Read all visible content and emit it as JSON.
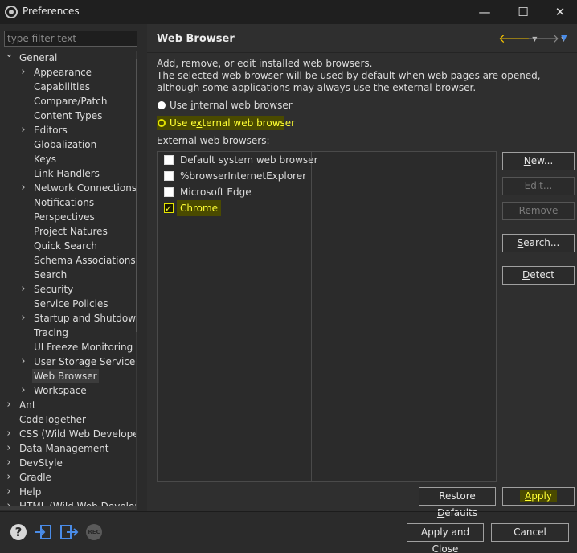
{
  "window": {
    "title": "Preferences",
    "minimize": "—",
    "maximize": "☐",
    "close": "✕"
  },
  "filter": {
    "placeholder": "type filter text",
    "value": ""
  },
  "tree": [
    {
      "label": "General",
      "arrow": "⌄",
      "level": 0
    },
    {
      "label": "Appearance",
      "arrow": "›",
      "level": 1
    },
    {
      "label": "Capabilities",
      "arrow": "",
      "level": 1
    },
    {
      "label": "Compare/Patch",
      "arrow": "",
      "level": 1
    },
    {
      "label": "Content Types",
      "arrow": "",
      "level": 1
    },
    {
      "label": "Editors",
      "arrow": "›",
      "level": 1
    },
    {
      "label": "Globalization",
      "arrow": "",
      "level": 1
    },
    {
      "label": "Keys",
      "arrow": "",
      "level": 1
    },
    {
      "label": "Link Handlers",
      "arrow": "",
      "level": 1
    },
    {
      "label": "Network Connections",
      "arrow": "›",
      "level": 1
    },
    {
      "label": "Notifications",
      "arrow": "",
      "level": 1
    },
    {
      "label": "Perspectives",
      "arrow": "",
      "level": 1
    },
    {
      "label": "Project Natures",
      "arrow": "",
      "level": 1
    },
    {
      "label": "Quick Search",
      "arrow": "",
      "level": 1
    },
    {
      "label": "Schema Associations",
      "arrow": "",
      "level": 1
    },
    {
      "label": "Search",
      "arrow": "",
      "level": 1
    },
    {
      "label": "Security",
      "arrow": "›",
      "level": 1
    },
    {
      "label": "Service Policies",
      "arrow": "",
      "level": 1
    },
    {
      "label": "Startup and Shutdown",
      "arrow": "›",
      "level": 1
    },
    {
      "label": "Tracing",
      "arrow": "",
      "level": 1
    },
    {
      "label": "UI Freeze Monitoring",
      "arrow": "",
      "level": 1
    },
    {
      "label": "User Storage Service",
      "arrow": "›",
      "level": 1
    },
    {
      "label": "Web Browser",
      "arrow": "",
      "level": 1,
      "selected": true
    },
    {
      "label": "Workspace",
      "arrow": "›",
      "level": 1
    },
    {
      "label": "Ant",
      "arrow": "›",
      "level": 0
    },
    {
      "label": "CodeTogether",
      "arrow": "",
      "level": 0
    },
    {
      "label": "CSS (Wild Web Developer",
      "arrow": "›",
      "level": 0
    },
    {
      "label": "Data Management",
      "arrow": "›",
      "level": 0
    },
    {
      "label": "DevStyle",
      "arrow": "›",
      "level": 0
    },
    {
      "label": "Gradle",
      "arrow": "›",
      "level": 0
    },
    {
      "label": "Help",
      "arrow": "›",
      "level": 0
    },
    {
      "label": "HTML (Wild Web Develop",
      "arrow": "›",
      "level": 0
    }
  ],
  "page": {
    "title": "Web Browser",
    "desc_line1": "Add, remove, or edit installed web browsers.",
    "desc_line2": "The selected web browser will be used by default when web pages are opened, although some applications may always use the external browser.",
    "radio_internal_pre": "Use ",
    "radio_internal_u": "i",
    "radio_internal_post": "nternal web browser",
    "radio_external_pre": "Use e",
    "radio_external_u": "x",
    "radio_external_post": "ternal web browser",
    "external_label": "External web browsers:",
    "browsers": [
      {
        "label": "Default system web browser",
        "checked": false
      },
      {
        "label": "%browserInternetExplorer",
        "checked": false
      },
      {
        "label": "Microsoft Edge",
        "checked": false
      },
      {
        "label": "Chrome",
        "checked": true
      }
    ]
  },
  "buttons": {
    "new_u": "N",
    "new_rest": "ew...",
    "edit_u": "E",
    "edit_rest": "dit...",
    "remove_u": "R",
    "remove_rest": "emove",
    "search_u": "S",
    "search_rest": "earch...",
    "detect_u": "D",
    "detect_rest": "etect",
    "restore_pre": "Restore ",
    "restore_u": "D",
    "restore_post": "efaults",
    "apply_u": "A",
    "apply_rest": "pply",
    "apply_close": "Apply and Close",
    "cancel": "Cancel"
  },
  "bottom_icons": {
    "help": "?",
    "rec": "REC"
  },
  "colors": {
    "highlight_text": "#ffff33",
    "highlight_bg": "#4a4a00",
    "nav_back": "#f5c400",
    "link_blue": "#4a8ce8"
  }
}
